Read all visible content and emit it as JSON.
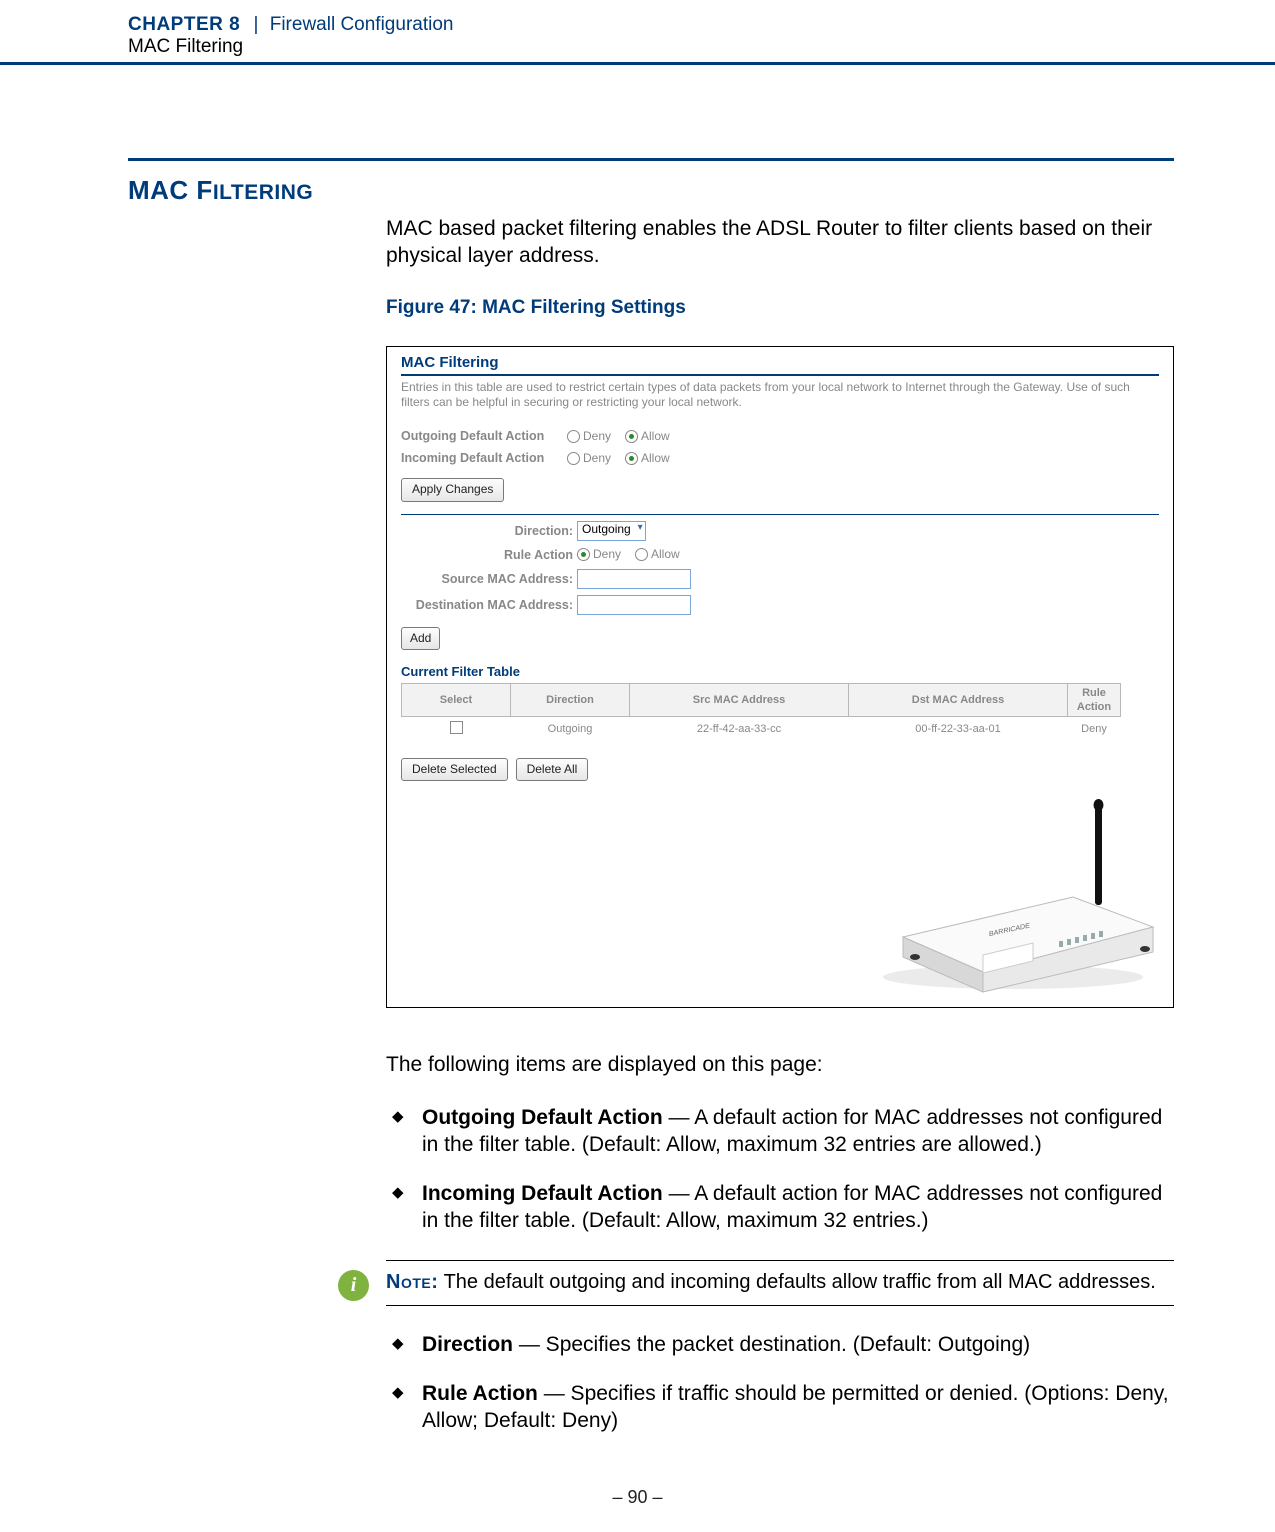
{
  "header": {
    "chapter_caps": "C",
    "chapter_rest": "HAPTER",
    "chapter_num": "8",
    "pipe": "|",
    "chapter_title": "Firewall Configuration",
    "subtitle": "MAC Filtering"
  },
  "section": {
    "heading_big": "MAC F",
    "heading_small": "ILTERING"
  },
  "intro": "MAC based packet filtering enables the ADSL Router to filter clients based on their physical layer address.",
  "figure_caption": "Figure 47:  MAC Filtering Settings",
  "shot": {
    "title": "MAC Filtering",
    "desc": "Entries in this table are used to restrict certain types of data packets from your local network to Internet through the Gateway. Use of such filters can be helpful in securing or restricting your local network.",
    "outgoing_label": "Outgoing Default Action",
    "incoming_label": "Incoming Default Action",
    "deny": "Deny",
    "allow": "Allow",
    "apply": "Apply Changes",
    "direction_label": "Direction:",
    "direction_value": "Outgoing",
    "rule_action_label": "Rule Action",
    "src_label": "Source MAC Address:",
    "dst_label": "Destination MAC Address:",
    "add": "Add",
    "table_title": "Current Filter Table",
    "th": {
      "select": "Select",
      "direction": "Direction",
      "src": "Src MAC Address",
      "dst": "Dst MAC Address",
      "rule": "Rule Action"
    },
    "row": {
      "direction": "Outgoing",
      "src": "22-ff-42-aa-33-cc",
      "dst": "00-ff-22-33-aa-01",
      "rule": "Deny"
    },
    "delete_selected": "Delete Selected",
    "delete_all": "Delete All"
  },
  "after_intro": "The following items are displayed on this page:",
  "bullets1": [
    {
      "term": "Outgoing Default Action",
      "desc": " — A default action for MAC addresses not configured in the filter table. (Default: Allow, maximum 32 entries are allowed.)"
    },
    {
      "term": "Incoming Default Action",
      "desc": " — A default action for MAC addresses not configured in the filter table. (Default: Allow, maximum 32 entries.)"
    }
  ],
  "note": {
    "label": "Note:",
    "text": " The default outgoing and incoming defaults allow traffic from all MAC addresses."
  },
  "bullets2": [
    {
      "term": "Direction",
      "desc": " — Specifies the packet destination. (Default: Outgoing)"
    },
    {
      "term": "Rule Action",
      "desc": " — Specifies if traffic should be permitted or denied. (Options: Deny, Allow; Default: Deny)"
    }
  ],
  "page_number": "–  90  –"
}
